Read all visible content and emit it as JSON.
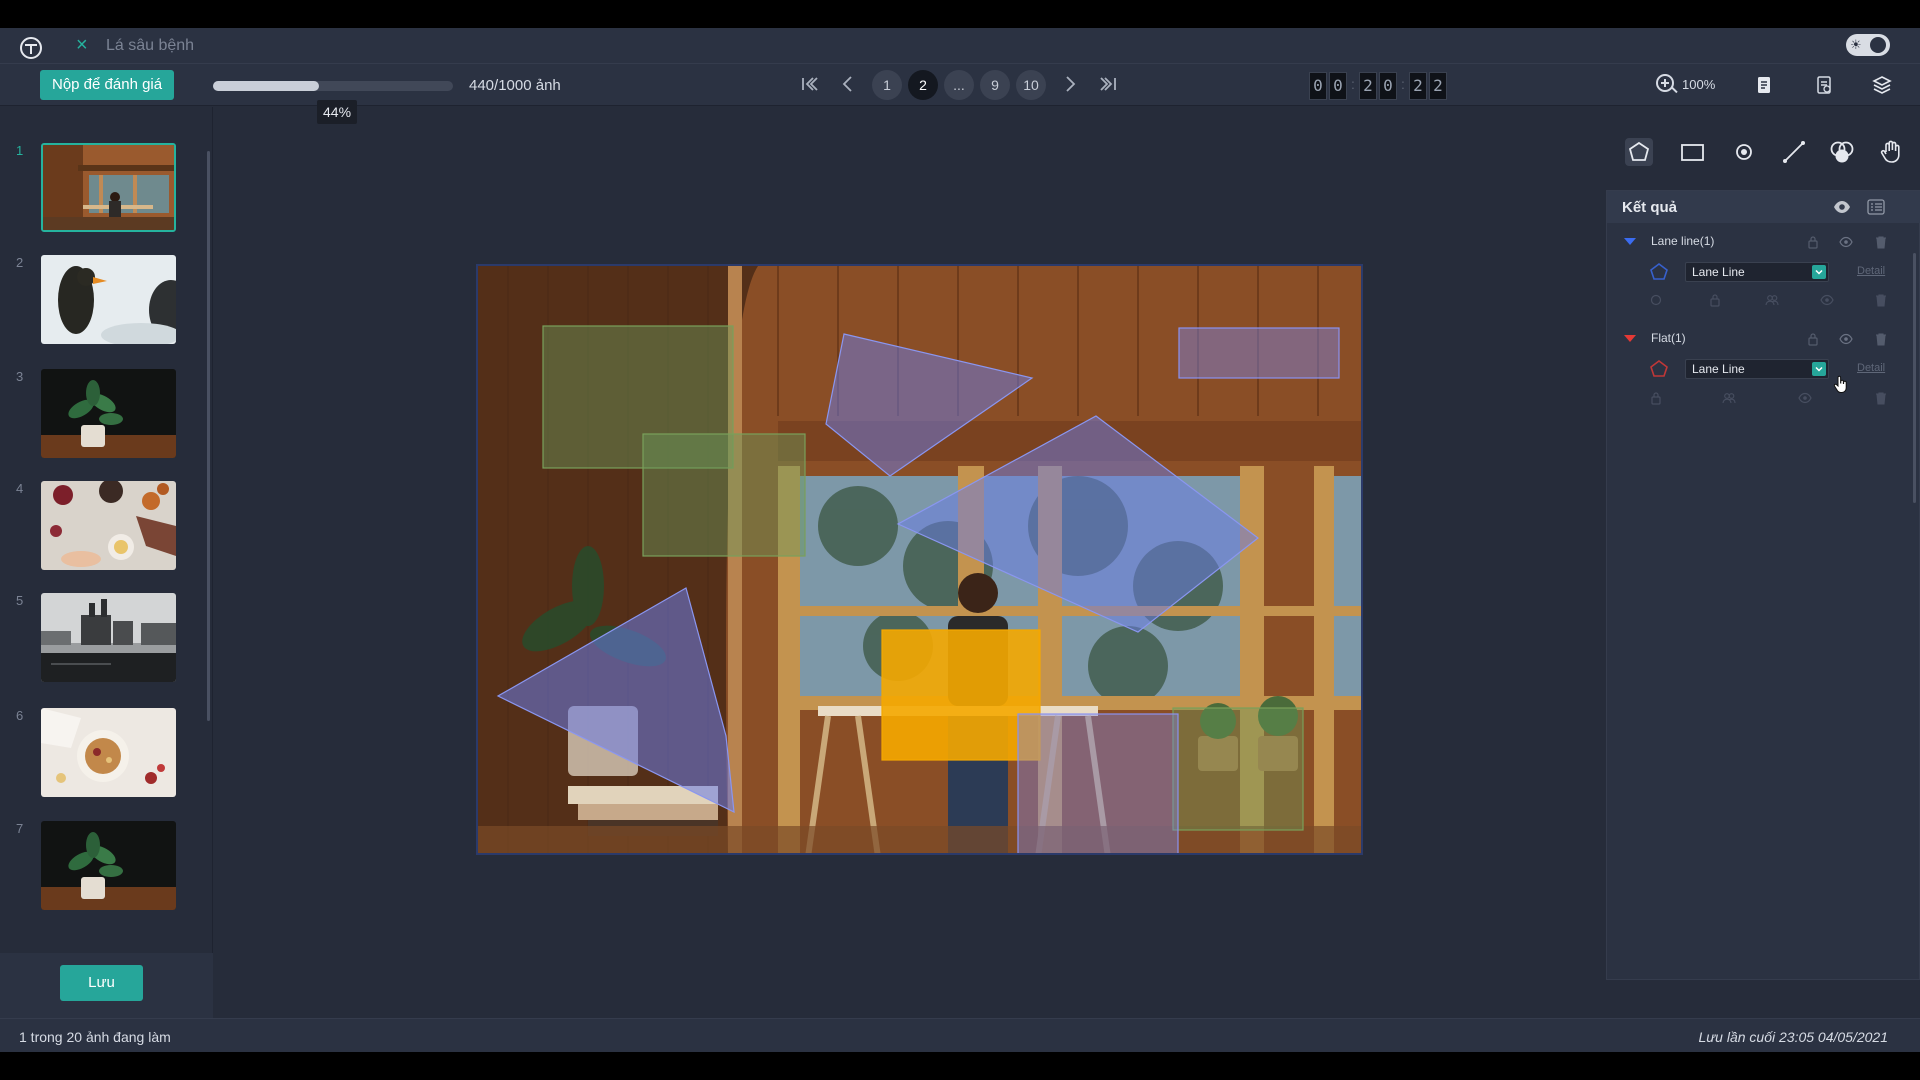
{
  "titlebar": {
    "title": "Lá sâu bệnh",
    "close_icon": "close-icon",
    "logo_icon": "app-logo-icon",
    "theme_toggle_icon": "theme-toggle-icon"
  },
  "toolbar": {
    "submit_label": "Nộp để đánh giá",
    "progress": {
      "value_fraction": 0.44,
      "percent_label": "44%",
      "count_label": "440/1000 ảnh"
    },
    "pager": {
      "pages": [
        "1",
        "2",
        "...",
        "9",
        "10"
      ],
      "current": "2"
    },
    "timer": {
      "digits": [
        "0",
        "0",
        "2",
        "0",
        "2",
        "2"
      ]
    },
    "zoom_label": "100%",
    "icons": [
      "first-page-icon",
      "prev-page-icon",
      "next-page-icon",
      "last-page-icon",
      "zoom-in-icon",
      "document-icon",
      "document-list-icon",
      "layers-icon"
    ]
  },
  "sidebar": {
    "thumbnails": [
      {
        "index": "1",
        "scene": "wooden room with window"
      },
      {
        "index": "2",
        "scene": "bird on snowy background"
      },
      {
        "index": "3",
        "scene": "potted plant dark"
      },
      {
        "index": "4",
        "scene": "breakfast food table"
      },
      {
        "index": "5",
        "scene": "winter castle by water"
      },
      {
        "index": "6",
        "scene": "cereal bowl"
      },
      {
        "index": "7",
        "scene": "potted plant dark"
      }
    ],
    "save_label": "Lưu"
  },
  "right_panel": {
    "tools": [
      "polygon-tool-icon",
      "rectangle-tool-icon",
      "point-tool-icon",
      "line-tool-icon",
      "color-filter-icon",
      "hand-tool-icon"
    ],
    "results_title": "Kết quả",
    "groups": [
      {
        "name": "Lane line(1)",
        "color": "#3b6cf0",
        "item_label": "Lane Line",
        "item_detail": "Detail"
      },
      {
        "name": "Flat(1)",
        "color": "#e53935",
        "item_label": "Lane Line",
        "item_detail": "Detail"
      }
    ]
  },
  "statusbar": {
    "left": "1 trong 20 ảnh đang làm",
    "right": "Lưu lần cuối 23:05 04/05/2021"
  },
  "colors": {
    "accent": "#26a69a",
    "annotation_blue": "#6a7be8",
    "annotation_green": "#7aa05a",
    "annotation_orange": "#f5a800"
  }
}
